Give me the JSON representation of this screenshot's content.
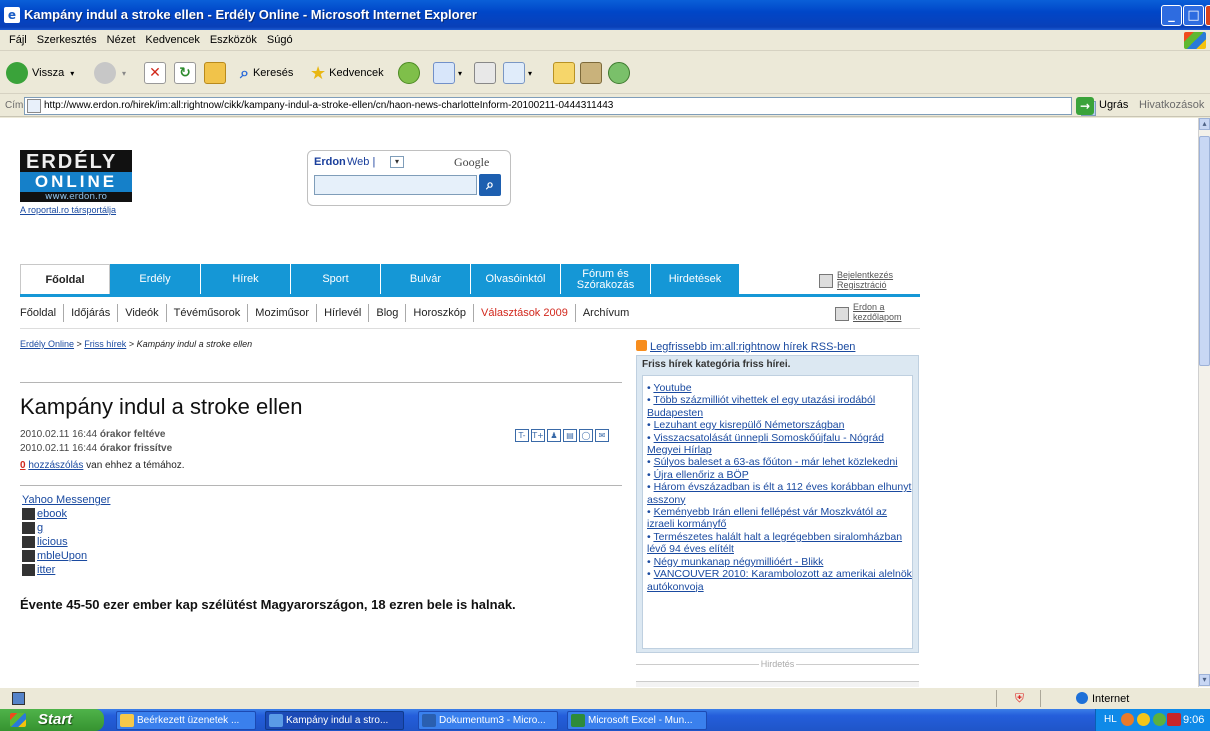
{
  "window": {
    "title": "Kampány indul a stroke ellen - Erdély Online - Microsoft Internet Explorer",
    "controls": {
      "minimize": "_",
      "maximize": "□",
      "close": "X"
    }
  },
  "menu": [
    "Fájl",
    "Szerkesztés",
    "Nézet",
    "Kedvencek",
    "Eszközök",
    "Súgó"
  ],
  "toolbar": {
    "back": "Vissza",
    "search": "Keresés",
    "favorites": "Kedvencek"
  },
  "address": {
    "label": "Cím",
    "url": "http://www.erdon.ro/hirek/im:all:rightnow/cikk/kampany-indul-a-stroke-ellen/cn/haon-news-charlotteInform-20100211-0444311443",
    "go": "Ugrás",
    "links": "Hivatkozások"
  },
  "logo": {
    "line1": "ERDÉLY",
    "line2": "ONLINE",
    "line3": "www.erdon.ro",
    "sub": "A roportal.ro társportálja"
  },
  "search": {
    "brand": "Erdon",
    "sep": "|",
    "scope": "Web |",
    "engine": "Google"
  },
  "tabs": [
    "Főoldal",
    "Erdély",
    "Hírek",
    "Sport",
    "Bulvár",
    "Olvasóinktól",
    "Fórum és Szórakozás",
    "Hirdetések"
  ],
  "account": {
    "login": "Bejelentkezés",
    "register": "Regisztráció"
  },
  "subnav": [
    "Főoldal",
    "Időjárás",
    "Videók",
    "Tévéműsorok",
    "Moziműsor",
    "Hírlevél",
    "Blog",
    "Horoszkóp",
    "Választások 2009",
    "Archívum"
  ],
  "homepage": {
    "line1": "Erdon a",
    "line2": "kezdőlapom"
  },
  "breadcrumb": {
    "home": "Erdély Online",
    "sep1": " > ",
    "section": "Friss hírek",
    "sep2": " > ",
    "current": "Kampány indul a stroke ellen"
  },
  "article": {
    "title": "Kampány indul a stroke ellen",
    "posted_time": "2010.02.11 16:44",
    "posted_label": "órakor feltéve",
    "updated_time": "2010.02.11 16:44",
    "updated_label": "órakor frissítve",
    "comments_count": "0",
    "comments_link": "hozzászólás",
    "comments_suffix": "van ehhez a témához.",
    "tool_icons": [
      "T-",
      "T+",
      "person",
      "print",
      "comment",
      "email"
    ],
    "share": [
      "Yahoo Messenger",
      "ebook",
      "g",
      "licious",
      "mbleUpon",
      "itter"
    ],
    "lead": "Évente 45-50 ezer ember kap szélütést Magyarországon, 18 ezren bele is halnak."
  },
  "sidebar": {
    "rss": "Legfrissebb im:all:rightnow hírek RSS-ben",
    "box_title": "Friss hírek kategória friss hírei.",
    "news": [
      "Youtube",
      "Több százmilliót vihettek el egy utazási irodából Budapesten",
      "Lezuhant egy kisrepülő Németországban",
      "Visszacsatolását ünnepli Somoskőújfalu - Nógrád Megyei Hírlap",
      "Súlyos baleset a 63-as főúton - már lehet közlekedni",
      "Újra ellenőriz a BÖP",
      "Három évszázadban is élt a 112 éves korábban elhunyt asszony",
      "Keményebb Irán elleni fellépést vár Moszkvától az izraeli kormányfő",
      "Természetes halált halt a legrégebben siralomházban lévő 94 éves elítélt",
      "Négy munkanap négymillióért - Blikk",
      "VANCOUVER 2010: Karambolozott az amerikai alelnök autókonvoja"
    ],
    "ad_label": "Hirdetés"
  },
  "status": {
    "zone": "Internet"
  },
  "taskbar": {
    "start": "Start",
    "tasks": [
      "Beérkezett üzenetek ...",
      "Kampány indul a stro...",
      "Dokumentum3 - Micro...",
      "Microsoft Excel - Mun..."
    ],
    "lang": "HL",
    "clock": "9:06"
  }
}
